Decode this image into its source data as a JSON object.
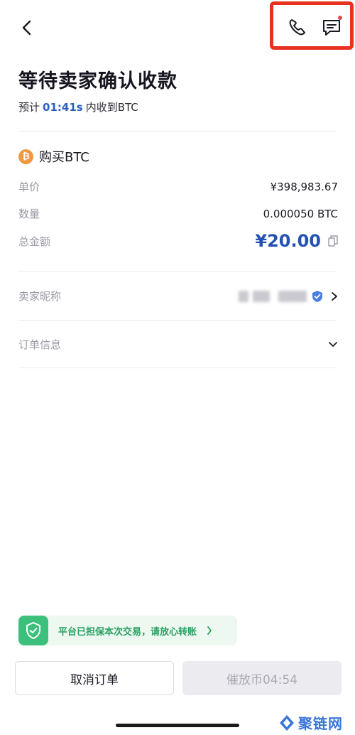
{
  "header": {
    "back_icon": "chevron-left-icon",
    "phone_icon": "phone-icon",
    "chat_icon": "chat-icon",
    "highlight_color": "#e8321f"
  },
  "status": {
    "title": "等待卖家确认收款",
    "eta_prefix": "预计",
    "eta_time": "01:41s",
    "eta_suffix": "内收到BTC"
  },
  "order": {
    "coin_icon": "bitcoin-icon",
    "coin_glyph": "₿",
    "buy_label": "购买BTC",
    "price_label": "单价",
    "price_value": "¥398,983.67",
    "qty_label": "数量",
    "qty_value": "0.000050 BTC",
    "total_label": "总金额",
    "total_value": "¥20.00"
  },
  "seller": {
    "label": "卖家昵称",
    "verified_icon": "verified-badge-icon"
  },
  "order_info": {
    "label": "订单信息"
  },
  "guarantee": {
    "text": "平台已担保本次交易，请放心转账"
  },
  "actions": {
    "cancel_label": "取消订单",
    "release_label": "催放币04:54"
  },
  "watermark": {
    "text": "聚链网"
  },
  "colors": {
    "accent": "#2452b3",
    "green": "#3ec07d",
    "disabled_bg": "#ececf0"
  }
}
